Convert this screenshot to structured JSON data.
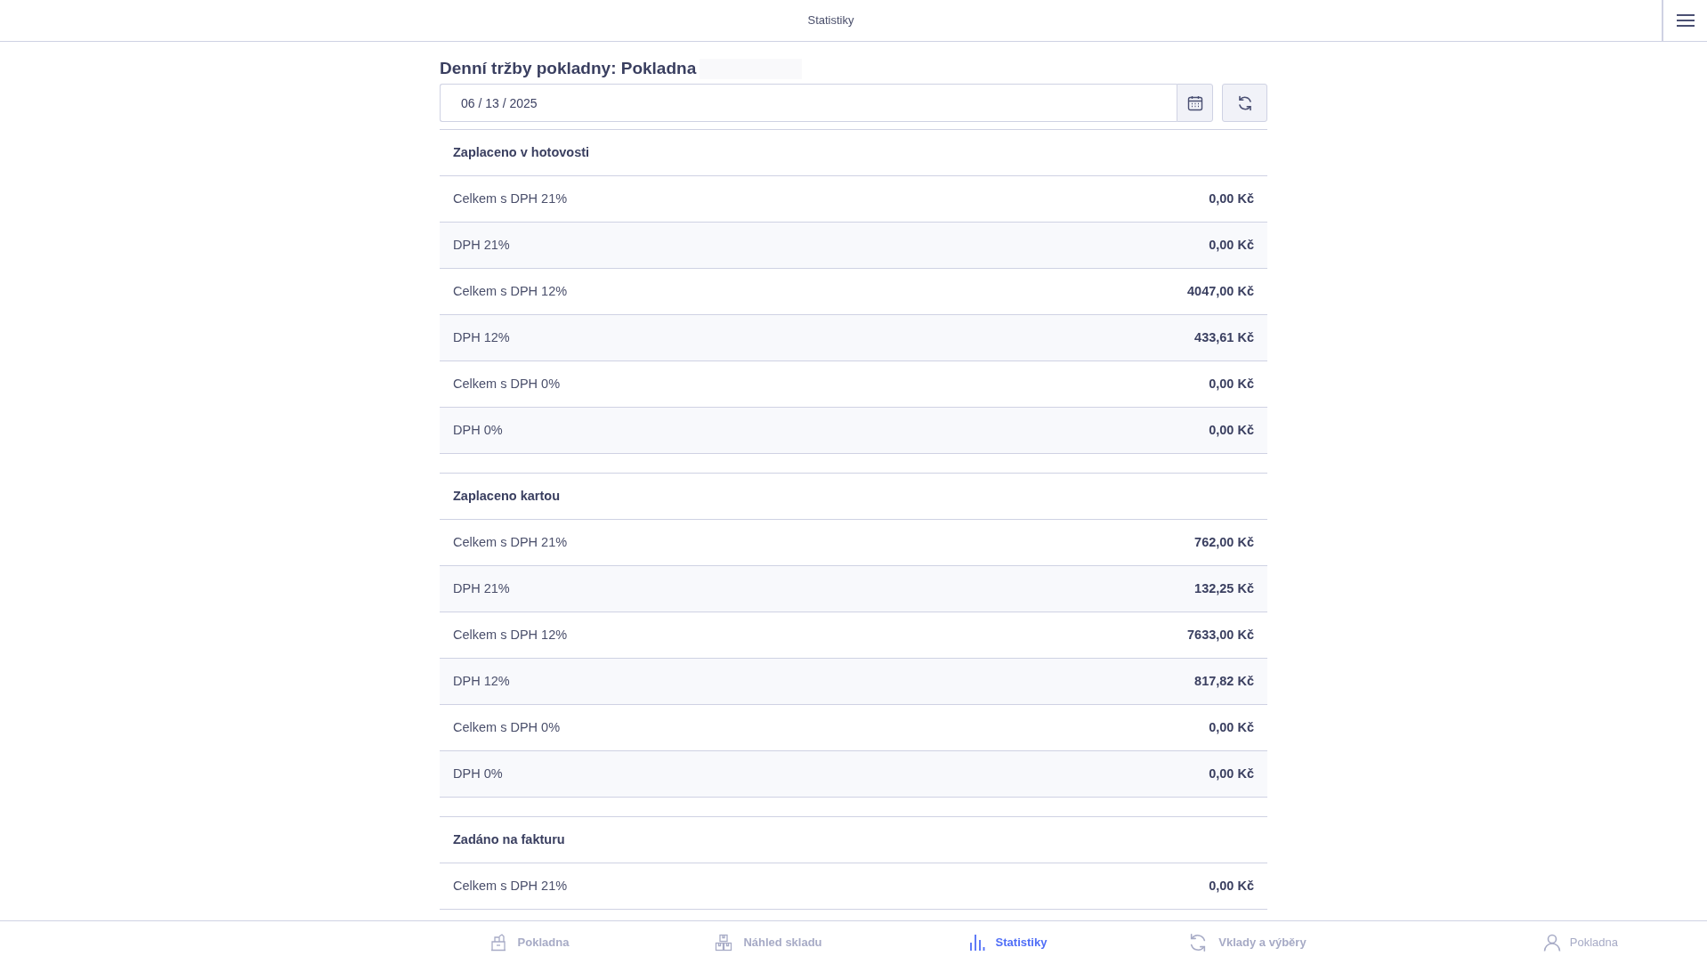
{
  "top_bar": {
    "title": "Statistiky"
  },
  "heading": "Denní tržby pokladny: Pokladna",
  "date_field": {
    "value": "06 / 13 / 2025"
  },
  "sections": [
    {
      "title": "Zaplaceno v hotovosti",
      "rows": [
        {
          "label": "Celkem s DPH 21%",
          "value": "0,00 Kč"
        },
        {
          "label": "DPH 21%",
          "value": "0,00 Kč"
        },
        {
          "label": "Celkem s DPH 12%",
          "value": "4047,00 Kč"
        },
        {
          "label": "DPH 12%",
          "value": "433,61 Kč"
        },
        {
          "label": "Celkem s DPH 0%",
          "value": "0,00 Kč"
        },
        {
          "label": "DPH 0%",
          "value": "0,00 Kč"
        }
      ]
    },
    {
      "title": "Zaplaceno kartou",
      "rows": [
        {
          "label": "Celkem s DPH 21%",
          "value": "762,00 Kč"
        },
        {
          "label": "DPH 21%",
          "value": "132,25 Kč"
        },
        {
          "label": "Celkem s DPH 12%",
          "value": "7633,00 Kč"
        },
        {
          "label": "DPH 12%",
          "value": "817,82 Kč"
        },
        {
          "label": "Celkem s DPH 0%",
          "value": "0,00 Kč"
        },
        {
          "label": "DPH 0%",
          "value": "0,00 Kč"
        }
      ]
    },
    {
      "title": "Zadáno na fakturu",
      "rows": [
        {
          "label": "Celkem s DPH 21%",
          "value": "0,00 Kč"
        }
      ]
    }
  ],
  "bottom_nav": {
    "items": [
      {
        "kind": "register",
        "label": "Pokladna",
        "selected": false
      },
      {
        "kind": "warehouse",
        "label": "Náhled skladu",
        "selected": false
      },
      {
        "kind": "stats",
        "label": "Statistiky",
        "selected": true
      },
      {
        "kind": "exchange",
        "label": "Vklady a výběry",
        "selected": false
      }
    ],
    "user": {
      "label": "Pokladna"
    }
  }
}
